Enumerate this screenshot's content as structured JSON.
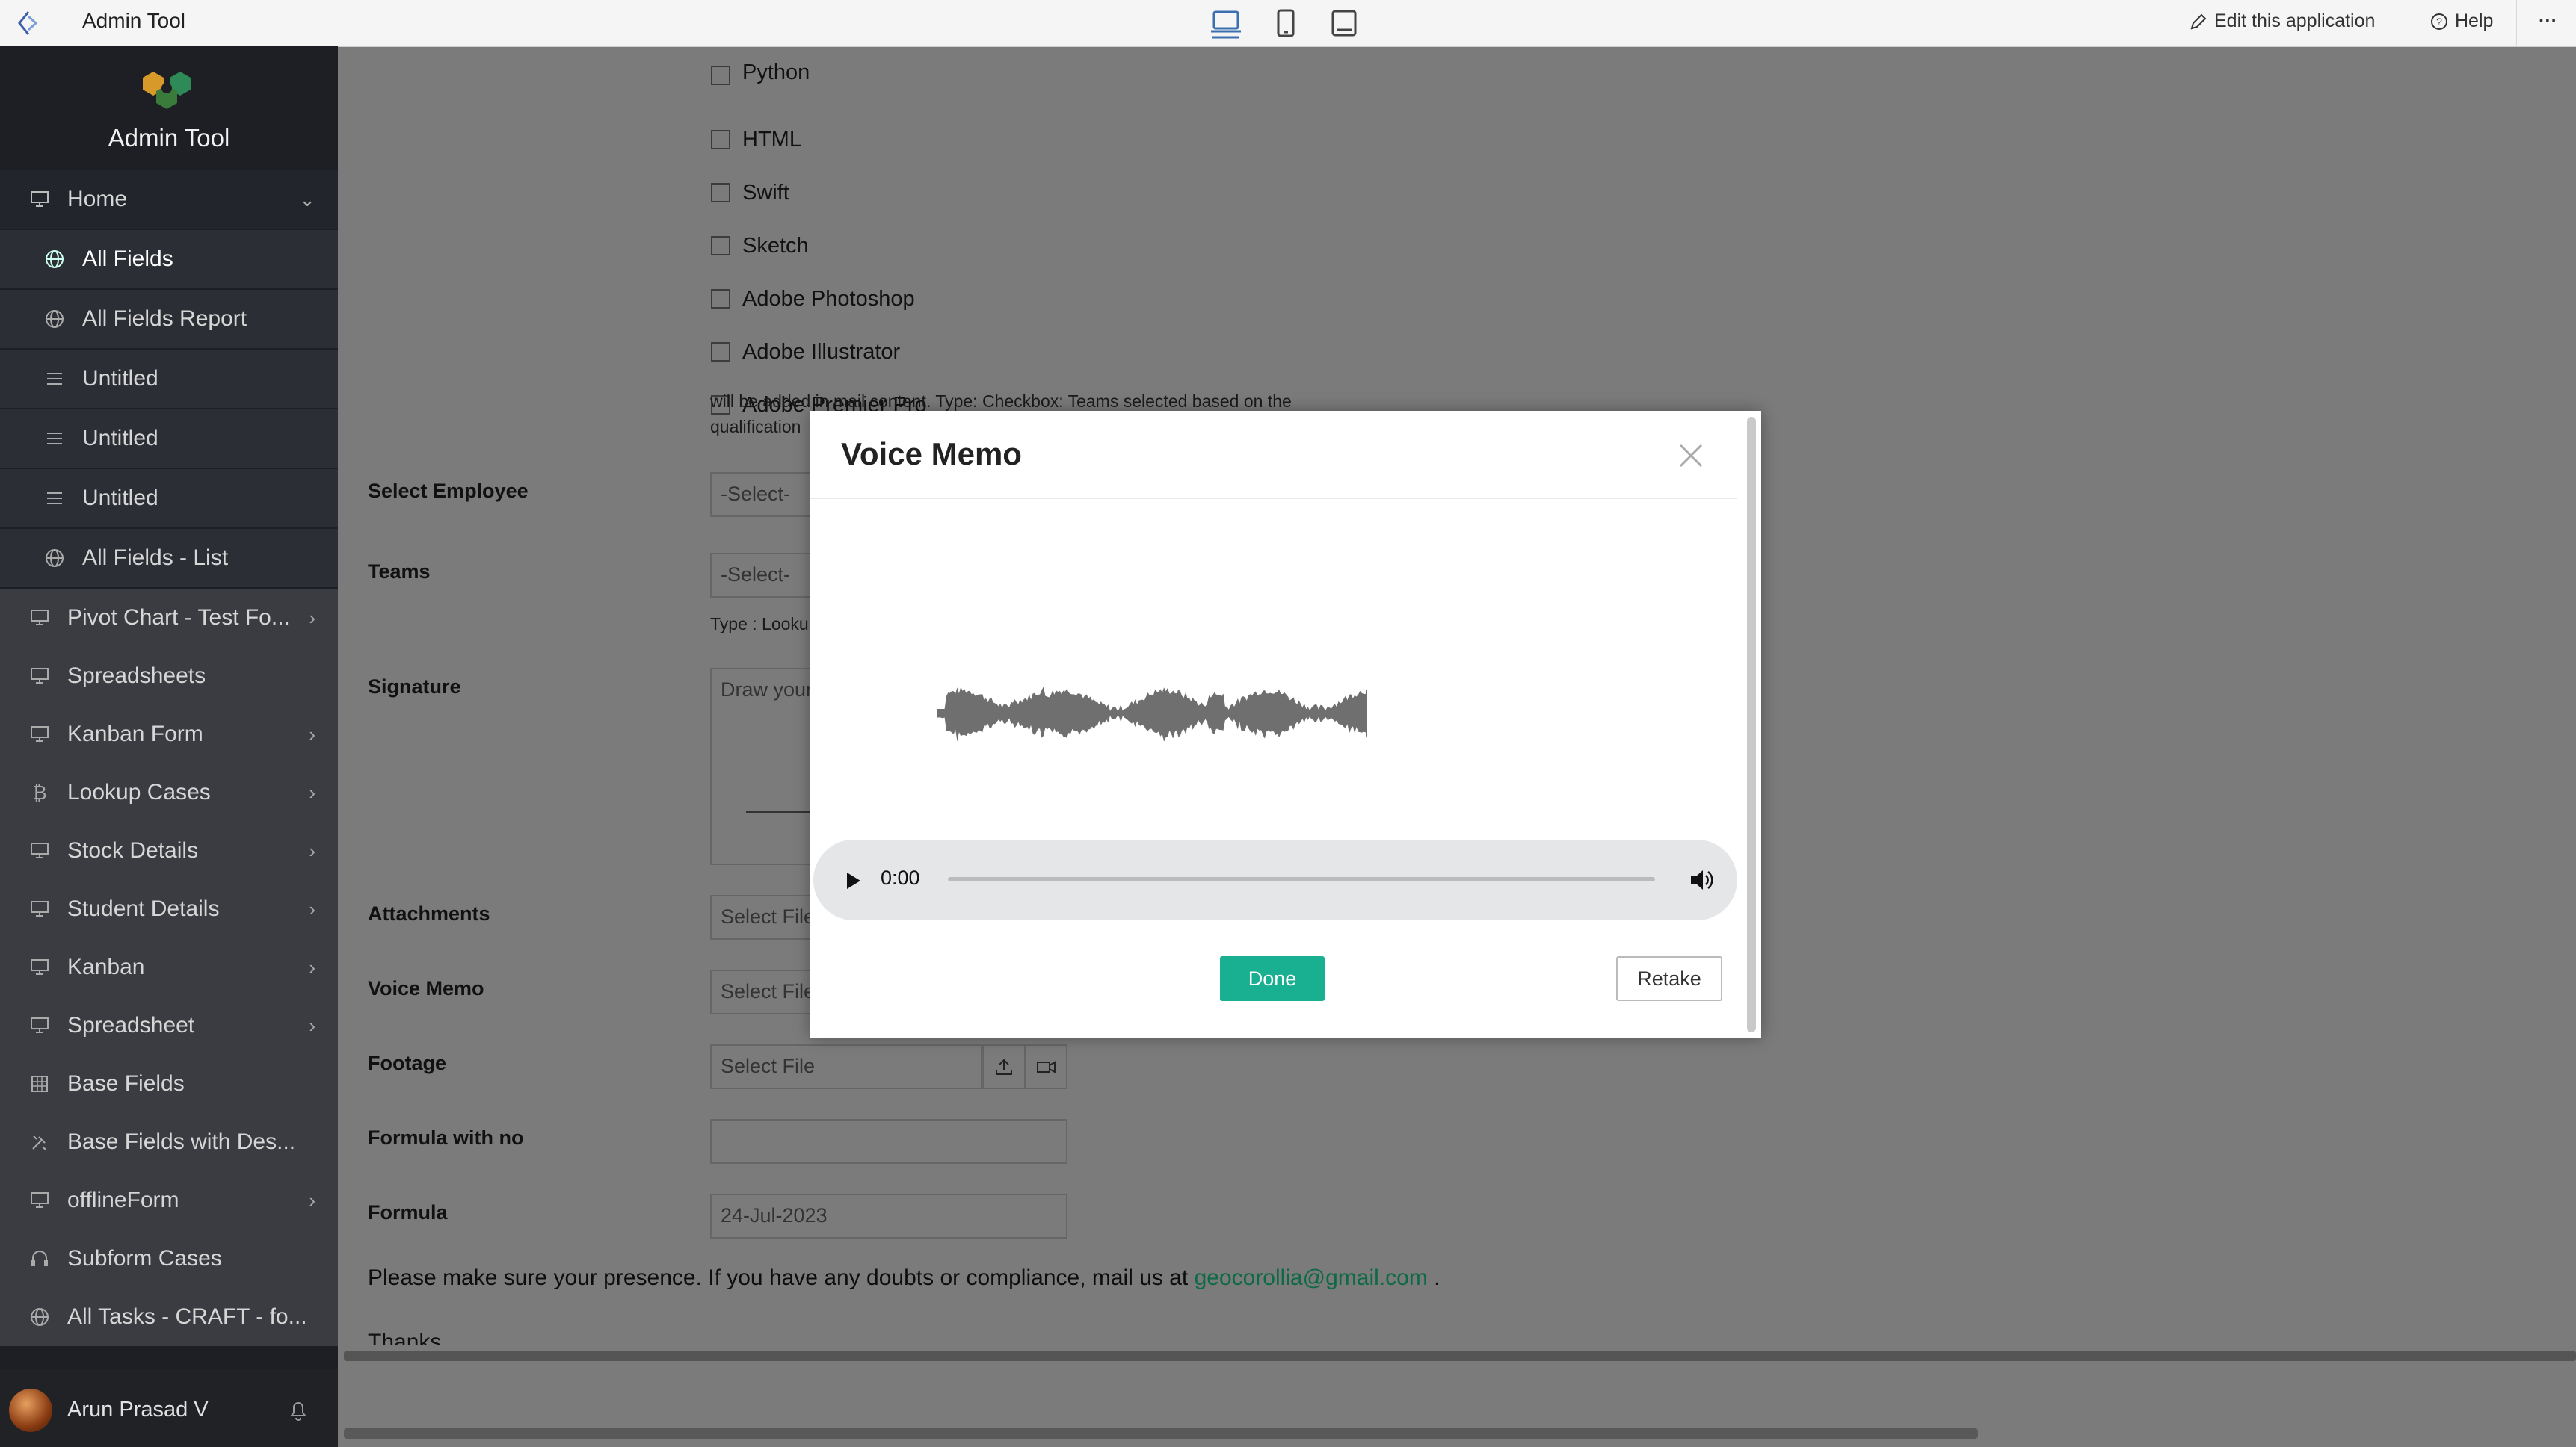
{
  "app": {
    "title": "Admin Tool"
  },
  "topbar": {
    "edit_label": "Edit this application",
    "help_label": "Help",
    "more_label": "···"
  },
  "sidebar": {
    "brand": "Admin Tool",
    "home": "Home",
    "items": [
      {
        "label": "All Fields",
        "icon": "globe-icon"
      },
      {
        "label": "All Fields Report",
        "icon": "globe-icon"
      },
      {
        "label": "Untitled",
        "icon": "list-icon"
      },
      {
        "label": "Untitled",
        "icon": "list-icon"
      },
      {
        "label": "Untitled",
        "icon": "list-icon"
      },
      {
        "label": "All Fields - List",
        "icon": "globe-icon"
      }
    ],
    "top_items": [
      {
        "label": "Pivot Chart - Test Fo...",
        "icon": "monitor-icon",
        "chevron": true
      },
      {
        "label": "Spreadsheets",
        "icon": "monitor-icon",
        "chevron": false
      },
      {
        "label": "Kanban Form",
        "icon": "monitor-icon",
        "chevron": true
      },
      {
        "label": "Lookup Cases",
        "icon": "bitcoin-icon",
        "chevron": true
      },
      {
        "label": "Stock Details",
        "icon": "monitor-icon",
        "chevron": true
      },
      {
        "label": "Student Details",
        "icon": "monitor-icon",
        "chevron": true
      },
      {
        "label": "Kanban",
        "icon": "monitor-icon",
        "chevron": true
      },
      {
        "label": "Spreadsheet",
        "icon": "monitor-icon",
        "chevron": true
      },
      {
        "label": "Base Fields",
        "icon": "grid-icon",
        "chevron": false
      },
      {
        "label": "Base Fields with Des...",
        "icon": "tools-icon",
        "chevron": false
      },
      {
        "label": "offlineForm",
        "icon": "monitor-icon",
        "chevron": true
      },
      {
        "label": "Subform Cases",
        "icon": "headset-icon",
        "chevron": false
      },
      {
        "label": "All Tasks - CRAFT - fo...",
        "icon": "globe-icon",
        "chevron": false
      }
    ],
    "user": {
      "name": "Arun Prasad V"
    }
  },
  "form": {
    "partial_option": "Python",
    "checkbox_options": [
      "HTML",
      "Swift",
      "Sketch",
      "Adobe Photoshop",
      "Adobe Illustrator",
      "Adobe Premier Pro"
    ],
    "checkbox_help_1": "will be added in mail content. Type: Checkbox: Teams selected based on the",
    "checkbox_help_2": "qualification",
    "select_employee_label": "Select Employee",
    "select_placeholder": "-Select-",
    "teams_label": "Teams",
    "teams_help": "Type : Lookup",
    "signature_label": "Signature",
    "signature_placeholder": "Draw your",
    "attachments_label": "Attachments",
    "select_file": "Select File",
    "voice_memo_label": "Voice Memo",
    "footage_label": "Footage",
    "formula_no_label": "Formula with no",
    "formula_label": "Formula",
    "formula_value": "24-Jul-2023",
    "mail_text": "Please make sure your presence. If you have any doubts or compliance, mail us at ",
    "mail_link": "geocorollia@gmail.com",
    "mail_end": " .",
    "thanks": "Thanks"
  },
  "modal": {
    "title": "Voice Memo",
    "time": "0:00",
    "done_label": "Done",
    "retake_label": "Retake",
    "playback_progress": 0
  },
  "colors": {
    "accent": "#18b091",
    "sidebar_active": "#1e6b50",
    "link": "#0e6a46"
  }
}
